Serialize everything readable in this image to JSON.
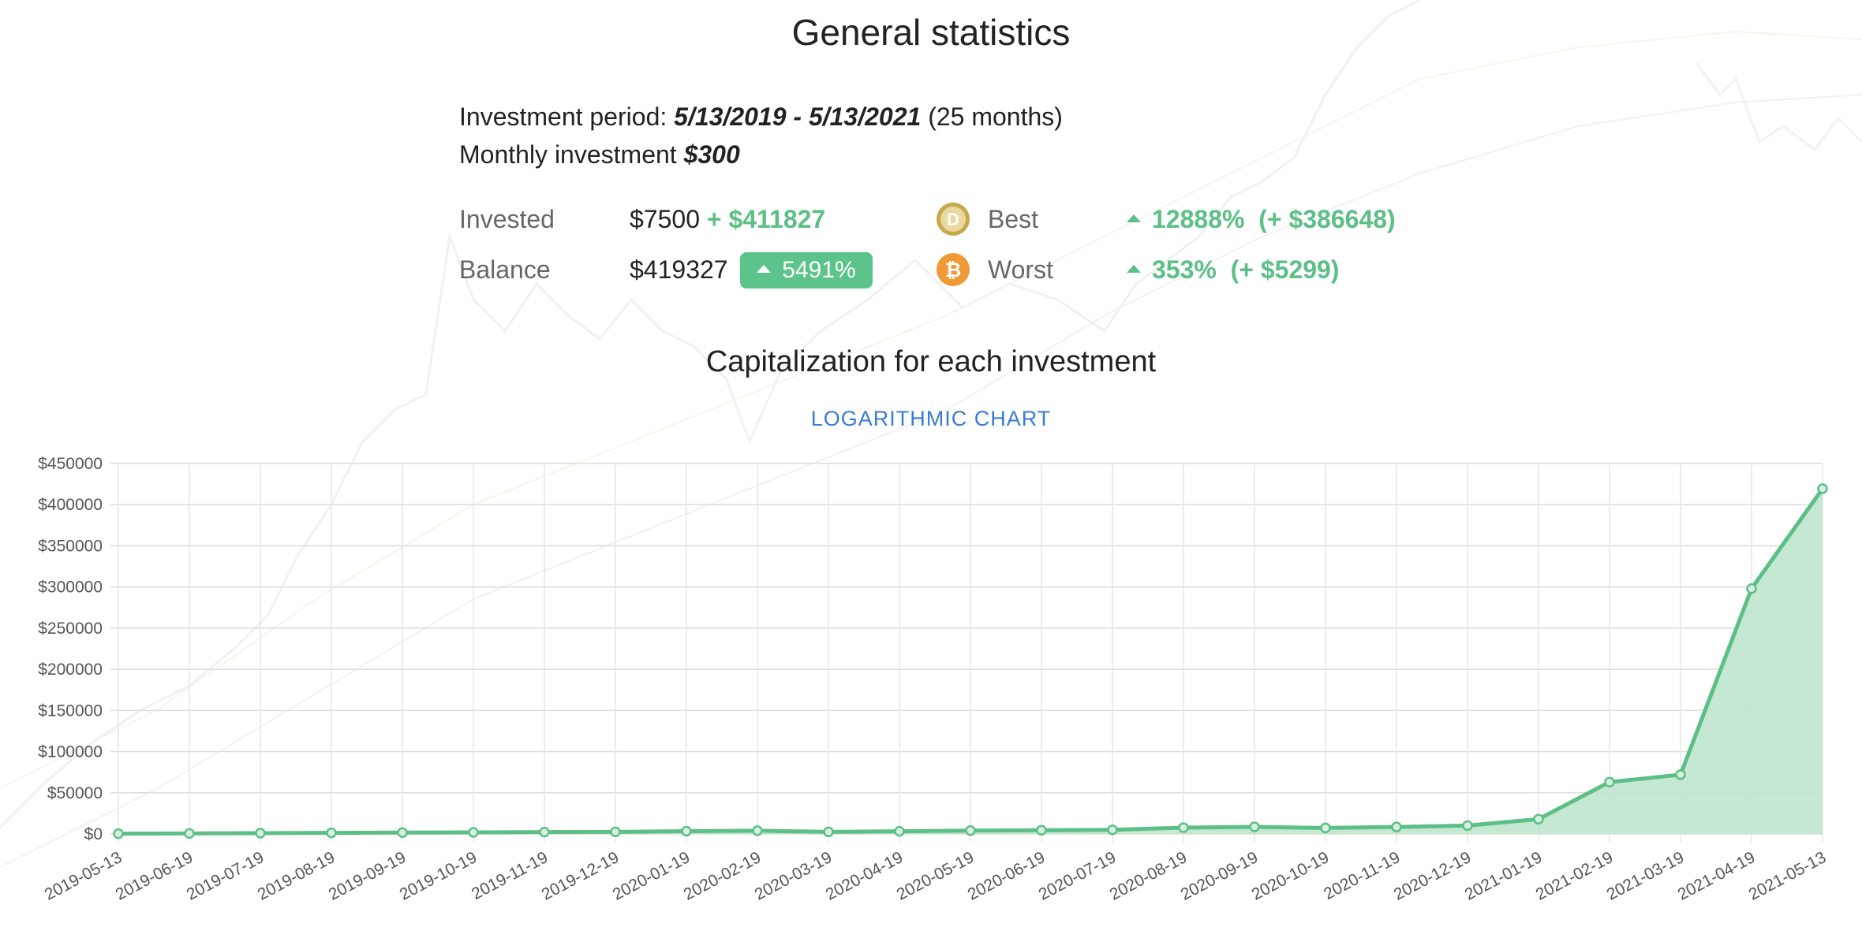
{
  "page_title": "General statistics",
  "period": {
    "label": "Investment period:",
    "range": "5/13/2019 - 5/13/2021",
    "duration": "(25 months)"
  },
  "monthly": {
    "label": "Monthly investment",
    "value": "$300"
  },
  "stats": {
    "invested_label": "Invested",
    "invested_value": "$7500",
    "profit": "+ $411827",
    "balance_label": "Balance",
    "balance_value": "$419327",
    "balance_pct": "5491%",
    "best_label": "Best",
    "best_pct": "12888%",
    "best_gain": "(+ $386648)",
    "best_icon": "dogecoin-icon",
    "worst_label": "Worst",
    "worst_pct": "353%",
    "worst_gain": "(+ $5299)",
    "worst_icon": "bitcoin-icon"
  },
  "colors": {
    "accent_green": "#5cbf86",
    "fill_green": "#bfe6cd",
    "link_blue": "#3a7bd5",
    "dogecoin": "#c8a94a",
    "bitcoin": "#f09a36"
  },
  "chart_title": "Capitalization for each investment",
  "log_chart_link": "LOGARITHMIC CHART",
  "chart_data": {
    "type": "area",
    "title": "Capitalization for each investment",
    "xlabel": "",
    "ylabel": "",
    "ylim": [
      0,
      450000
    ],
    "yticks": [
      0,
      50000,
      100000,
      150000,
      200000,
      250000,
      300000,
      350000,
      400000,
      450000
    ],
    "ytick_labels": [
      "$0",
      "$50000",
      "$100000",
      "$150000",
      "$200000",
      "$250000",
      "$300000",
      "$350000",
      "$400000",
      "$450000"
    ],
    "grid": true,
    "legend": "none",
    "x": [
      "2019-05-13",
      "2019-06-19",
      "2019-07-19",
      "2019-08-19",
      "2019-09-19",
      "2019-10-19",
      "2019-11-19",
      "2019-12-19",
      "2020-01-19",
      "2020-02-19",
      "2020-03-19",
      "2020-04-19",
      "2020-05-19",
      "2020-06-19",
      "2020-07-19",
      "2020-08-19",
      "2020-09-19",
      "2020-10-19",
      "2020-11-19",
      "2020-12-19",
      "2021-01-19",
      "2021-02-19",
      "2021-03-19",
      "2021-04-19",
      "2021-05-13"
    ],
    "series": [
      {
        "values": [
          300,
          650,
          950,
          1300,
          1700,
          1900,
          2300,
          2500,
          3300,
          4000,
          2500,
          3200,
          4100,
          4500,
          5000,
          7700,
          8600,
          7300,
          8500,
          10200,
          18000,
          63000,
          72000,
          298000,
          419327
        ]
      }
    ]
  }
}
